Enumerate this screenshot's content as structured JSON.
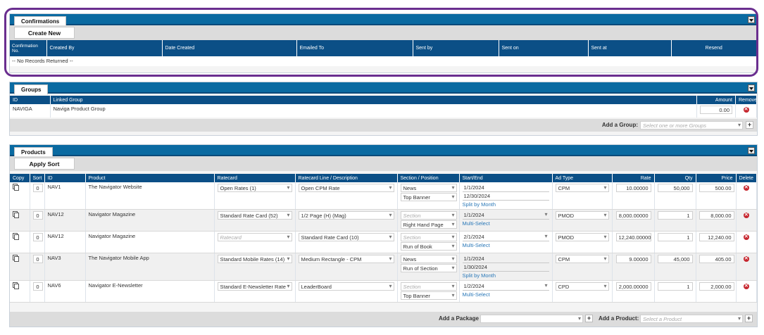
{
  "confirmations": {
    "tab": "Confirmations",
    "create_button": "Create New",
    "columns": [
      "Confirmation No.",
      "Created By",
      "Date Created",
      "Emailed To",
      "Sent by",
      "Sent on",
      "Sent at",
      "Resend"
    ],
    "empty_text": "-- No Records Returned --"
  },
  "groups": {
    "tab": "Groups",
    "columns": {
      "id": "ID",
      "linked": "Linked Group",
      "amount": "Amount",
      "remove": "Remove"
    },
    "row": {
      "id": "NAVIGA",
      "name": "Naviga Product Group",
      "amount": "0.00"
    },
    "add_label": "Add a Group:",
    "add_placeholder": "Select one or more Groups"
  },
  "products": {
    "tab": "Products",
    "sort_button": "Apply Sort",
    "columns": [
      "Copy",
      "Sort",
      "ID",
      "Product",
      "Ratecard",
      "Ratecard Line / Description",
      "Section / Position",
      "Start/End",
      "Ad Type",
      "Rate",
      "Qty",
      "Price",
      "Delete"
    ],
    "rows": [
      {
        "sort": "0",
        "id": "NAV1",
        "product": "The Navigator Website",
        "ratecard": "Open Rates (1)",
        "line": "Open CPM Rate",
        "section": "News",
        "position": "Top Banner",
        "start": "1/1/2024",
        "end": "12/30/2024",
        "link": "Split by Month",
        "adtype": "CPM",
        "rate": "10.00000",
        "qty": "50,000",
        "price": "500.00"
      },
      {
        "sort": "0",
        "id": "NAV12",
        "product": "Navigator Magazine",
        "ratecard": "Standard Rate Card (52)",
        "line": "1/2 Page (H) (Mag)",
        "section": "Section",
        "position": "Right Hand Page",
        "start": "1/1/2024",
        "end": "",
        "link": "Multi-Select",
        "adtype": "PMOD",
        "rate": "8,000.00000",
        "qty": "1",
        "price": "8,000.00"
      },
      {
        "sort": "0",
        "id": "NAV12",
        "product": "Navigator Magazine",
        "ratecard": "Ratecard",
        "line": "Standard Rate Card (10)",
        "section": "Section",
        "position": "Run of Book",
        "start": "2/1/2024",
        "end": "",
        "link": "Multi-Select",
        "adtype": "PMOD",
        "rate": "12,240.00000",
        "qty": "1",
        "price": "12,240.00"
      },
      {
        "sort": "0",
        "id": "NAV3",
        "product": "The Navigator Mobile App",
        "ratecard": "Standard Mobile Rates (14)",
        "line": "Medium Rectangle - CPM",
        "section": "News",
        "position": "Run of Section",
        "start": "1/1/2024",
        "end": "1/30/2024",
        "link": "Split by Month",
        "adtype": "CPM",
        "rate": "9.00000",
        "qty": "45,000",
        "price": "405.00"
      },
      {
        "sort": "0",
        "id": "NAV6",
        "product": "Navigator E-Newsletter",
        "ratecard": "Standard E-Newsletter Rate",
        "line": "LeaderBoard",
        "section": "Section",
        "position": "Top Banner",
        "start": "1/2/2024",
        "end": "",
        "link": "Multi-Select",
        "adtype": "CPD",
        "rate": "2,000.00000",
        "qty": "1",
        "price": "2,000.00"
      }
    ],
    "add_package_label": "Add a Package",
    "add_product_label": "Add a Product:",
    "add_product_placeholder": "Select a Product",
    "delete_glyph": "✕",
    "plus_glyph": "+"
  }
}
